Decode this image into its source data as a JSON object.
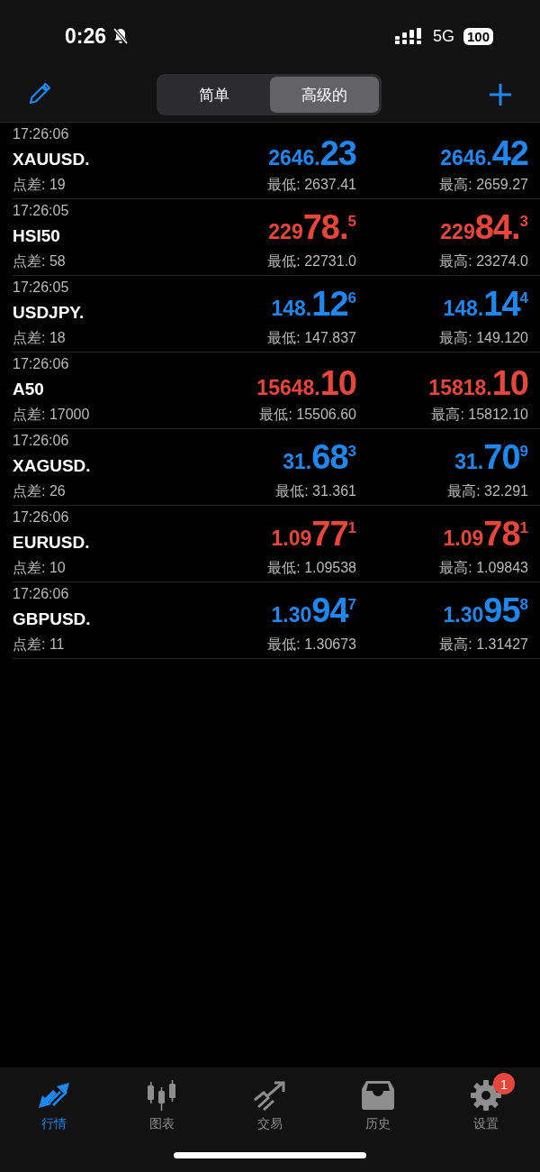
{
  "status_bar": {
    "time": "0:26",
    "network": "5G",
    "battery": "100",
    "silent": true
  },
  "segments": [
    {
      "label": "简单",
      "selected": false
    },
    {
      "label": "高级的",
      "selected": true
    }
  ],
  "quotes": [
    {
      "time": "17:26:06",
      "symbol": "XAUUSD.",
      "spread": "点差: 19",
      "color": "#1e87f0",
      "bid": {
        "small": "2646.",
        "big": "23"
      },
      "ask": {
        "small": "2646.",
        "big": "42"
      },
      "low": "最低: 2637.41",
      "high": "最高: 2659.27"
    },
    {
      "time": "17:26:05",
      "symbol": "HSI50",
      "spread": "点差: 58",
      "color": "#e8463a",
      "bid": {
        "small": "229",
        "big": "78.",
        "sup": "5"
      },
      "ask": {
        "small": "229",
        "big": "84.",
        "sup": "3"
      },
      "low": "最低: 22731.0",
      "high": "最高: 23274.0"
    },
    {
      "time": "17:26:05",
      "symbol": "USDJPY.",
      "spread": "点差: 18",
      "color": "#1e87f0",
      "bid": {
        "small": "148.",
        "big": "12",
        "sup": "6"
      },
      "ask": {
        "small": "148.",
        "big": "14",
        "sup": "4"
      },
      "low": "最低: 147.837",
      "high": "最高: 149.120"
    },
    {
      "time": "17:26:06",
      "symbol": "A50",
      "spread": "点差: 17000",
      "color": "#e8463a",
      "bid": {
        "small": "15648.",
        "big": "10"
      },
      "ask": {
        "small": "15818.",
        "big": "10"
      },
      "low": "最低: 15506.60",
      "high": "最高: 15812.10"
    },
    {
      "time": "17:26:06",
      "symbol": "XAGUSD.",
      "spread": "点差: 26",
      "color": "#1e87f0",
      "bid": {
        "small": "31.",
        "big": "68",
        "sup": "3"
      },
      "ask": {
        "small": "31.",
        "big": "70",
        "sup": "9"
      },
      "low": "最低: 31.361",
      "high": "最高: 32.291"
    },
    {
      "time": "17:26:06",
      "symbol": "EURUSD.",
      "spread": "点差: 10",
      "color": "#e8463a",
      "bid": {
        "small": "1.09",
        "big": "77",
        "sup": "1"
      },
      "ask": {
        "small": "1.09",
        "big": "78",
        "sup": "1"
      },
      "low": "最低: 1.09538",
      "high": "最高: 1.09843"
    },
    {
      "time": "17:26:06",
      "symbol": "GBPUSD.",
      "spread": "点差: 11",
      "color": "#1e87f0",
      "bid": {
        "small": "1.30",
        "big": "94",
        "sup": "7"
      },
      "ask": {
        "small": "1.30",
        "big": "95",
        "sup": "8"
      },
      "low": "最低: 1.30673",
      "high": "最高: 1.31427"
    }
  ],
  "tab_bar": [
    {
      "kind": "quotes",
      "label": "行情",
      "selected": true
    },
    {
      "kind": "chart",
      "label": "图表",
      "selected": false
    },
    {
      "kind": "trade",
      "label": "交易",
      "selected": false
    },
    {
      "kind": "history",
      "label": "历史",
      "selected": false
    },
    {
      "kind": "settings",
      "label": "设置",
      "selected": false,
      "badge": "1"
    }
  ]
}
